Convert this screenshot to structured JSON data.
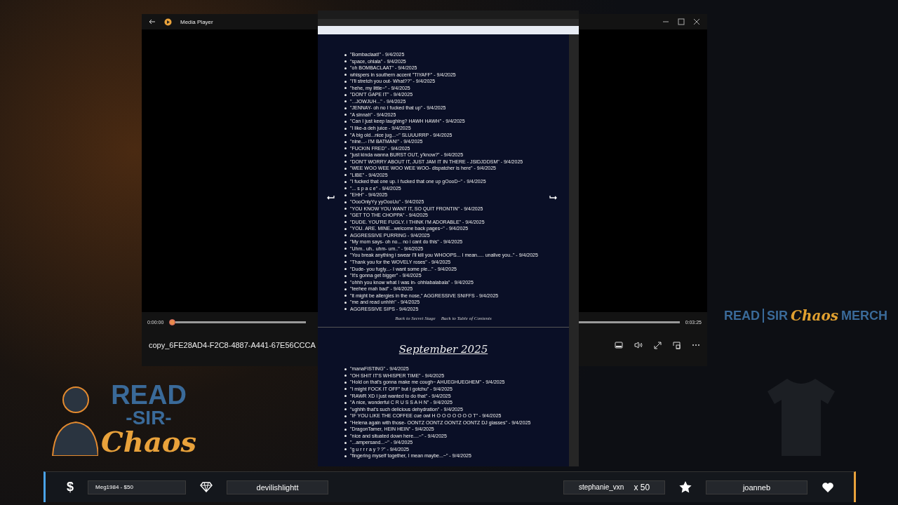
{
  "media_player": {
    "title": "Media Player",
    "progress": {
      "level": 0,
      "elapsed": "0:00:00",
      "duration": "0:03:25"
    },
    "file_name": "copy_6FE28AD4-F2C8-4887-A441-67E56CCCA"
  },
  "browser": {
    "sections": [
      {
        "items": [
          "\"Bombaclaat!\" - 9/4/2025",
          "\"space, ohlala\" - 9/4/2025",
          "\"oh BOMBACLAAT\" - 9/4/2025",
          "whispers in southern accent \"TIYAFF\" - 9/4/2025",
          "\"I'll stretch you out- What??\" - 9/4/2025",
          "\"hehe, my little~\" - 9/4/2025",
          "\"DON'T GAPE IT\" - 9/4/2025",
          "\"...JOWJUH...\" - 9/4/2025",
          "\"JENNAY- oh no I fucked that up\" - 9/4/2025",
          "\"A sinnah\" - 9/4/2025",
          "\"Can I just keep laughing? HAWH HAWH\" - 9/4/2025",
          "\"I like-a deh juice - 9/4/2025",
          "\"A big old...nice jug...~\" SLUUURRP - 9/4/2025",
          "\"nine...- I'M BATMAN!\" - 9/4/2025",
          "\"FUCKIN FRED\" - 9/4/2025",
          "\"just kinda wanna BURST OUT, y'know?\" - 9/4/2025",
          "\"DON'T WORRY ABOUT IT, JUST JAM IT IN THERE - JSIDJDDSM\" - 9/4/2025",
          "\"WEE WOO WEE WOO WEE WOO- dispatcher is here\" - 9/4/2025",
          "\"LIBE\" - 9/4/2025",
          "\"I fucked that one up. I fucked that one up gOooD~\" - 9/4/2025",
          "\"... s p a c e\" - 9/4/2025",
          "\"EHH\" - 9/4/2025",
          "\"OooOnlyYy yyOooUu\" - 9/4/2025",
          "\"YOU KNOW YOU WANT IT, SO QUIT FRONTIN\" - 9/4/2025",
          "\"GET TO THE CHOPPA\" - 9/4/2025",
          "\"DUDE. YOU'RE FUGLY. I THINK I'M ADORABLE\" - 9/4/2025",
          "\"YOU. ARE. MINE...welcome back pages~\" - 9/4/2025",
          "AGGRESSIVE PURRING - 9/4/2025",
          "\"My mom says- oh no... no i cant do this\" - 9/4/2025",
          "\"Uhm.. uh.. uhm- um..\" - 9/4/2025",
          "\"You break anything i swear I'll kill you WHOOPS... I mean..... unalive you..\" - 9/4/2025",
          "\"Thank you for the WOVELY roses\" - 9/4/2025",
          "\"Dude- you fugly...- I want some pie...\" - 9/4/2025",
          "\"It's gonna get bigger\" - 9/4/2025",
          "\"ohhh you know what I was in- ohhlabalabala\" - 9/4/2025",
          "\"teehee mah bad\" - 9/4/2025",
          "\"it might be allergies in the nose,\" AGGRESSIVE SNIFFS - 9/4/2025",
          "\"me and read unhhh\" - 9/4/2025",
          "AGGRESSIVE SIPS - 9/4/2025"
        ],
        "links": [
          "Back to Secret Stage",
          "Back to Table of Contents"
        ]
      },
      {
        "heading": "September 2025",
        "items": [
          "\"manaFISTING\" - 9/4/2025",
          "\"OH SHIT IT'S WHISPER TIME\" - 9/4/2025",
          "\"Hold on that's gonna make me cough~ AHUEGHUEGHEM\" - 9/4/2025",
          "\"I might FOCK IT OFF\" but I gotchu\" - 9/4/2025",
          "\"RAWR XD I just wanted to do that\" - 9/4/2025",
          "\"A nice, wonderful C R U S S A H N\" - 9/4/2025",
          "\"ughhh that's such delicious dehydration\" - 9/4/2025",
          "\"IF YOU LIKE THE COFFEE cue owl H O O O O O O O T\" - 9/4/2025",
          "\"Helena again with those- OONTZ OONTZ OONTZ OONTZ DJ glasses\" - 9/4/2025",
          "\"DragonTamer, HEIN HEIN\" - 9/4/2025",
          "\"nice and situated down here....~\" - 9/4/2025",
          "\"...ampersand...~\" - 9/4/2025",
          "\"g u r r r a y ? ?\" - 9/4/2025",
          "\"fingering myself together, I mean maybe...~\" - 9/4/2025"
        ]
      }
    ]
  },
  "logo": {
    "line_1": "READ",
    "line_2": "-SIR-",
    "line_3": "Chaos"
  },
  "merch": {
    "read": "READ",
    "sir": "SIR",
    "chaos": "Chaos",
    "merch": "MERCH"
  },
  "bottom_bar": {
    "currency": "$",
    "donation": "Meg1984 - $50",
    "follower": "devilishlightt",
    "gifter": "stephanie_vxn",
    "gift_count": "x 50",
    "subscriber": "joanneb"
  }
}
